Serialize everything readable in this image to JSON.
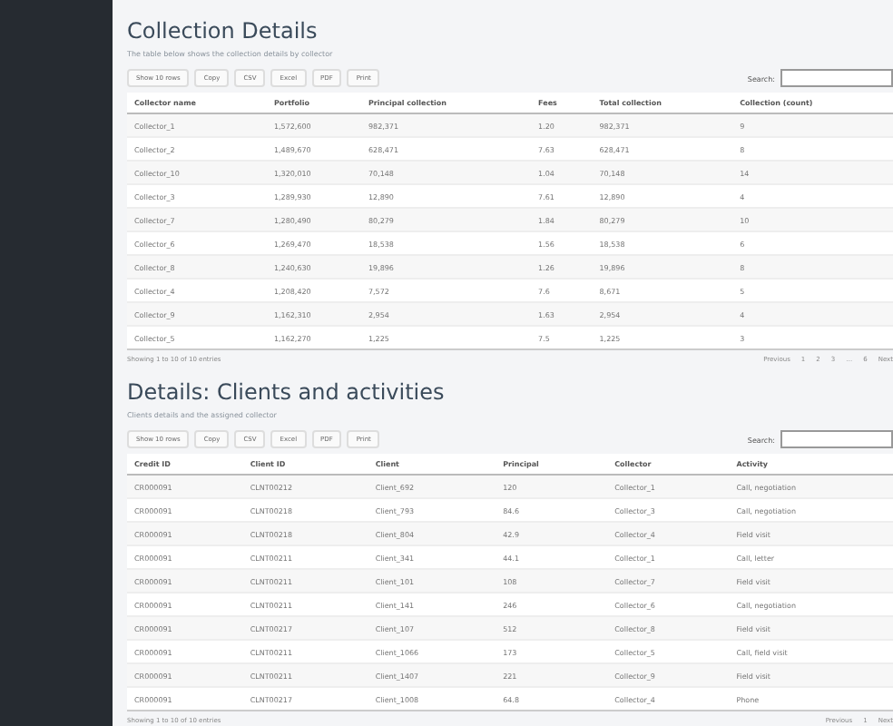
{
  "sections": [
    {
      "title": "Collection Details",
      "subtitle": "The table below shows the collection details by collector",
      "buttons": [
        "Show 10 rows",
        "Copy",
        "CSV",
        "Excel",
        "PDF",
        "Print"
      ],
      "search_label": "Search:",
      "columns": [
        "Collector name",
        "Portfolio",
        "Principal collection",
        "Fees",
        "Total collection",
        "Collection (count)"
      ],
      "rows": [
        [
          "Collector_1",
          "1,572,600",
          "982,371",
          "1.20",
          "982,371",
          "9"
        ],
        [
          "Collector_2",
          "1,489,670",
          "628,471",
          "7.63",
          "628,471",
          "8"
        ],
        [
          "Collector_10",
          "1,320,010",
          "70,148",
          "1.04",
          "70,148",
          "14"
        ],
        [
          "Collector_3",
          "1,289,930",
          "12,890",
          "7.61",
          "12,890",
          "4"
        ],
        [
          "Collector_7",
          "1,280,490",
          "80,279",
          "1.84",
          "80,279",
          "10"
        ],
        [
          "Collector_6",
          "1,269,470",
          "18,538",
          "1.56",
          "18,538",
          "6"
        ],
        [
          "Collector_8",
          "1,240,630",
          "19,896",
          "1.26",
          "19,896",
          "8"
        ],
        [
          "Collector_4",
          "1,208,420",
          "7,572",
          "7.6",
          "8,671",
          "5"
        ],
        [
          "Collector_9",
          "1,162,310",
          "2,954",
          "1.63",
          "2,954",
          "4"
        ],
        [
          "Collector_5",
          "1,162,270",
          "1,225",
          "7.5",
          "1,225",
          "3"
        ]
      ],
      "footer": "Showing 1 to 10 of 10 entries",
      "pages": [
        "Previous",
        "1",
        "2",
        "3",
        "…",
        "6",
        "Next"
      ]
    },
    {
      "title": "Details: Clients and activities",
      "subtitle": "Clients details and the assigned collector",
      "buttons": [
        "Show 10 rows",
        "Copy",
        "CSV",
        "Excel",
        "PDF",
        "Print"
      ],
      "search_label": "Search:",
      "columns": [
        "Credit ID",
        "Client ID",
        "Client",
        "Principal",
        "Collector",
        "Activity"
      ],
      "rows": [
        [
          "CR000091",
          "CLNT00212",
          "Client_692",
          "120",
          "Collector_1",
          "Call, negotiation"
        ],
        [
          "CR000091",
          "CLNT00218",
          "Client_793",
          "84.6",
          "Collector_3",
          "Call, negotiation"
        ],
        [
          "CR000091",
          "CLNT00218",
          "Client_804",
          "42.9",
          "Collector_4",
          "Field visit"
        ],
        [
          "CR000091",
          "CLNT00211",
          "Client_341",
          "44.1",
          "Collector_1",
          "Call, letter"
        ],
        [
          "CR000091",
          "CLNT00211",
          "Client_101",
          "108",
          "Collector_7",
          "Field visit"
        ],
        [
          "CR000091",
          "CLNT00211",
          "Client_141",
          "246",
          "Collector_6",
          "Call, negotiation"
        ],
        [
          "CR000091",
          "CLNT00217",
          "Client_107",
          "512",
          "Collector_8",
          "Field visit"
        ],
        [
          "CR000091",
          "CLNT00211",
          "Client_1066",
          "173",
          "Collector_5",
          "Call, field visit"
        ],
        [
          "CR000091",
          "CLNT00211",
          "Client_1407",
          "221",
          "Collector_9",
          "Field visit"
        ],
        [
          "CR000091",
          "CLNT00217",
          "Client_1008",
          "64.8",
          "Collector_4",
          "Phone"
        ]
      ],
      "footer": "Showing 1 to 10 of 10 entries",
      "pages": [
        "Previous",
        "1",
        "Next"
      ]
    }
  ]
}
